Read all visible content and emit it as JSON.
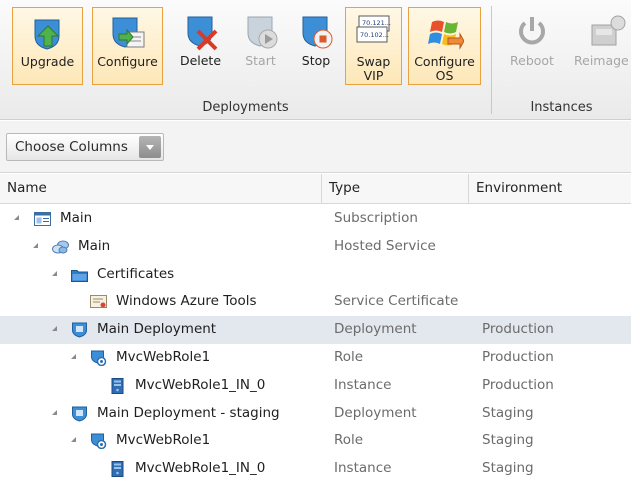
{
  "ribbon": {
    "buttons": [
      {
        "label": "Upgrade",
        "icon": "upgrade-icon"
      },
      {
        "label": "Configure",
        "icon": "configure-icon"
      },
      {
        "label": "Delete",
        "icon": "delete-icon"
      },
      {
        "label": "Start",
        "icon": "start-icon"
      },
      {
        "label": "Stop",
        "icon": "stop-icon"
      },
      {
        "label": "Swap\nVIP",
        "icon": "swap-vip-icon",
        "icon_text": [
          "70.121...",
          "70.102..."
        ]
      },
      {
        "label": "Configure\nOS",
        "icon": "configure-os-icon"
      },
      {
        "label": "Reboot",
        "icon": "reboot-icon"
      },
      {
        "label": "Reimage",
        "icon": "reimage-icon"
      }
    ],
    "groups": [
      "Deployments",
      "Instances"
    ],
    "accent": "#e8a33f"
  },
  "toolbar": {
    "choose_columns": "Choose Columns"
  },
  "grid": {
    "columns": [
      "Name",
      "Type",
      "Environment"
    ],
    "rows": [
      {
        "name": "Main",
        "type": "Subscription",
        "env": "",
        "icon": "subscription-icon"
      },
      {
        "name": "Main",
        "type": "Hosted Service",
        "env": "",
        "icon": "hosted-service-icon"
      },
      {
        "name": "Certificates",
        "type": "",
        "env": "",
        "icon": "folder-icon"
      },
      {
        "name": "Windows Azure Tools",
        "type": "Service Certificate",
        "env": "",
        "icon": "certificate-icon"
      },
      {
        "name": "Main Deployment",
        "type": "Deployment",
        "env": "Production",
        "icon": "deployment-icon",
        "selected": true
      },
      {
        "name": "MvcWebRole1",
        "type": "Role",
        "env": "Production",
        "icon": "role-icon"
      },
      {
        "name": "MvcWebRole1_IN_0",
        "type": "Instance",
        "env": "Production",
        "icon": "instance-icon"
      },
      {
        "name": "Main Deployment - staging",
        "type": "Deployment",
        "env": "Staging",
        "icon": "deployment-icon"
      },
      {
        "name": "MvcWebRole1",
        "type": "Role",
        "env": "Staging",
        "icon": "role-icon"
      },
      {
        "name": "MvcWebRole1_IN_0",
        "type": "Instance",
        "env": "Staging",
        "icon": "instance-icon"
      }
    ]
  }
}
